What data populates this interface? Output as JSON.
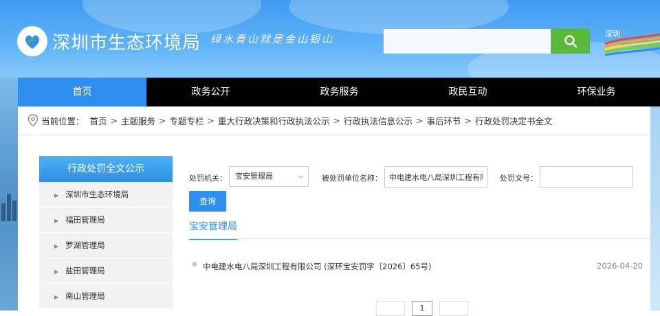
{
  "header": {
    "site_title": "深圳市生态环境局",
    "slogan": "绿水青山就是金山银山",
    "search_placeholder": "",
    "search_icon": "search-icon",
    "brand_logo_text": "深圳",
    "colors": {
      "header_blue": "#3f9bf0",
      "search_green": "#5ab83a",
      "nav_black": "#000000",
      "nav_active": "#2e8ff0"
    }
  },
  "nav": {
    "items": [
      {
        "label": "首页",
        "active": true
      },
      {
        "label": "政务公开"
      },
      {
        "label": "政务服务"
      },
      {
        "label": "政民互动"
      },
      {
        "label": "环保业务"
      }
    ]
  },
  "breadcrumb": {
    "icon": "location-pin-icon",
    "prefix": "当前位置：",
    "separator": ">",
    "items": [
      "首页",
      "主题服务",
      "专题专栏",
      "重大行政决策和行政执法公示",
      "行政执法信息公示",
      "事后环节",
      "行政处罚决定书全文"
    ]
  },
  "sidebar": {
    "title": "行政处罚全文公示",
    "items": [
      {
        "label": "深圳市生态环境局"
      },
      {
        "label": "福田管理局"
      },
      {
        "label": "罗湖管理局"
      },
      {
        "label": "盐田管理局"
      },
      {
        "label": "南山管理局"
      }
    ]
  },
  "filters": {
    "authority_label": "处罚机关：",
    "authority_value": "宝安管理局",
    "unit_label": "被处罚单位名称：",
    "unit_value": "中电建水电八局深圳工程有限公司",
    "doc_label": "处罚文号：",
    "doc_value": "",
    "query_button": "查询"
  },
  "section": {
    "title": "宝安管理局"
  },
  "results": [
    {
      "title": "中电建水电八局深圳工程有限公司 (深环宝安罚字〔2026〕65号)",
      "date": "2026-04-20"
    }
  ],
  "pager": {
    "prev": "",
    "current": "1",
    "next": ""
  }
}
